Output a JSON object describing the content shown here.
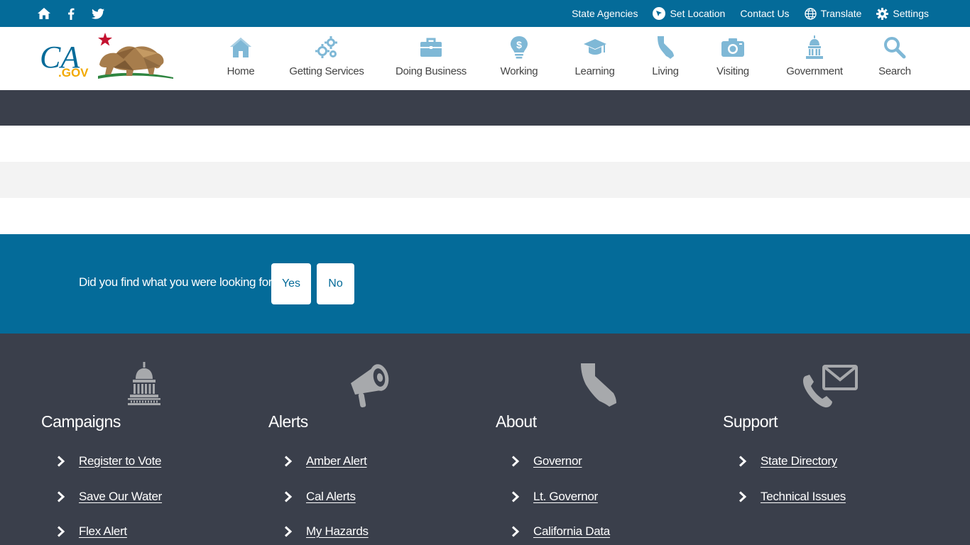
{
  "utility": {
    "social": [
      {
        "icon": "home-icon"
      },
      {
        "icon": "facebook-icon"
      },
      {
        "icon": "twitter-icon"
      }
    ],
    "links": {
      "state_agencies": "State Agencies",
      "set_location": "Set Location",
      "contact_us": "Contact Us",
      "translate": "Translate",
      "settings": "Settings"
    }
  },
  "brand": {
    "logo_text": "CA",
    "logo_suffix": ".GOV"
  },
  "nav": [
    {
      "label": "Home",
      "icon": "house-icon"
    },
    {
      "label": "Getting Services",
      "icon": "gears-icon"
    },
    {
      "label": "Doing Business",
      "icon": "briefcase-icon"
    },
    {
      "label": "Working",
      "icon": "lightbulb-dollar-icon"
    },
    {
      "label": "Learning",
      "icon": "graduation-cap-icon"
    },
    {
      "label": "Living",
      "icon": "california-icon"
    },
    {
      "label": "Visiting",
      "icon": "camera-icon"
    },
    {
      "label": "Government",
      "icon": "capitol-icon"
    },
    {
      "label": "Search",
      "icon": "search-icon"
    }
  ],
  "feedback": {
    "question": "Did you find what you were looking for?",
    "yes": "Yes",
    "no": "No"
  },
  "footer": {
    "columns": [
      {
        "title": "Campaigns",
        "icon": "capitol-icon",
        "links": [
          "Register to Vote",
          "Save Our Water",
          "Flex Alert"
        ]
      },
      {
        "title": "Alerts",
        "icon": "megaphone-icon",
        "links": [
          "Amber Alert",
          "Cal Alerts",
          "My Hazards"
        ]
      },
      {
        "title": "About",
        "icon": "california-icon",
        "links": [
          "Governor",
          "Lt. Governor",
          "California Data"
        ]
      },
      {
        "title": "Support",
        "icon": "phone-mail-icon",
        "links": [
          "State Directory",
          "Technical Issues"
        ]
      }
    ]
  },
  "colors": {
    "primary": "#046b99",
    "dark": "#3a3f4b",
    "nav_icon": "#7fb8d6",
    "footer_icon": "#a7a9ac"
  }
}
